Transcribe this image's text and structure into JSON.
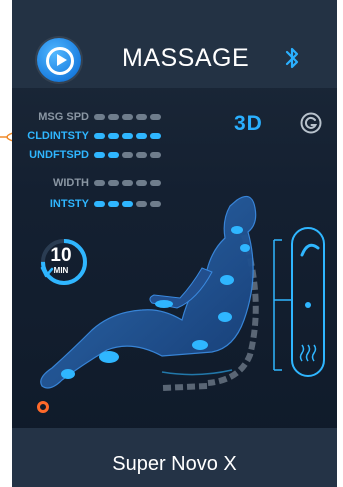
{
  "header": {
    "title": "MASSAGE",
    "play_icon": "play-circle-icon",
    "bluetooth_icon": "bluetooth-icon"
  },
  "levels": [
    {
      "label": "MSG SPD",
      "active": 0,
      "total": 5,
      "color": "#8a96a3"
    },
    {
      "label": "CLDINTSTY",
      "active": 5,
      "total": 5,
      "color": "#2fb6ff"
    },
    {
      "label": "UNDFTSPD",
      "active": 2,
      "total": 5,
      "color": "#2fb6ff"
    },
    {
      "label": "WIDTH",
      "active": 0,
      "total": 5,
      "color": "#8a96a3"
    },
    {
      "label": "INTSTY",
      "active": 3,
      "total": 5,
      "color": "#2fb6ff"
    }
  ],
  "mode_badge": "3D",
  "g_icon": "g-mode-icon",
  "timer": {
    "value": "10",
    "unit": "MIN",
    "progress": 0.75
  },
  "footer": {
    "title": "Super Novo X"
  },
  "colors": {
    "accent": "#2fb6ff",
    "highlight": "#f08a2a",
    "leg_marker": "#ff6a2a"
  }
}
